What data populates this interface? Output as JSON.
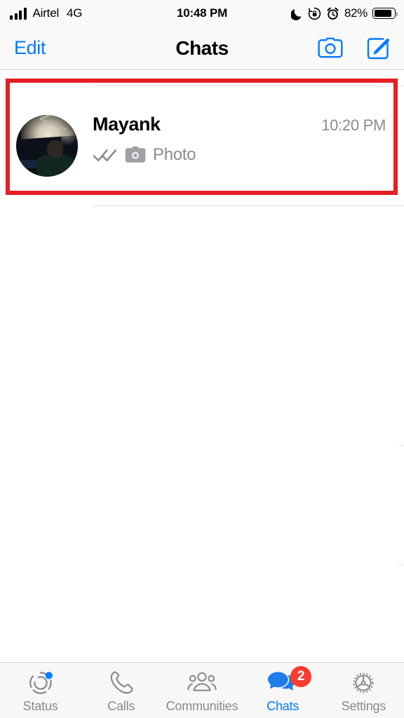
{
  "status_bar": {
    "carrier": "Airtel",
    "network": "4G",
    "time": "10:48 PM",
    "battery_percent": "82%",
    "icons": [
      "signal-bars-icon",
      "moon-icon",
      "rotation-lock-icon",
      "alarm-icon",
      "battery-icon"
    ]
  },
  "nav_bar": {
    "edit_label": "Edit",
    "title": "Chats",
    "camera_icon": "camera-icon",
    "compose_icon": "compose-icon"
  },
  "chats": [
    {
      "name": "Mayank",
      "time": "10:20 PM",
      "preview": "Photo",
      "status_icon": "double-check-icon",
      "media_icon": "camera-icon",
      "avatar": "contact-avatar"
    }
  ],
  "annotation": {
    "color": "#e61e25",
    "target": "chat-row-mayank"
  },
  "tab_bar": {
    "items": [
      {
        "label": "Status",
        "icon": "status-ring-icon",
        "active": false,
        "badge": ""
      },
      {
        "label": "Calls",
        "icon": "phone-icon",
        "active": false,
        "badge": ""
      },
      {
        "label": "Communities",
        "icon": "communities-icon",
        "active": false,
        "badge": ""
      },
      {
        "label": "Chats",
        "icon": "chat-bubbles-icon",
        "active": true,
        "badge": "2"
      },
      {
        "label": "Settings",
        "icon": "gear-icon",
        "active": false,
        "badge": ""
      }
    ]
  },
  "colors": {
    "accent_blue": "#027aff",
    "badge_red": "#fb3b30",
    "annotation_red": "#e61e25",
    "secondary_text": "#8c8c91"
  }
}
